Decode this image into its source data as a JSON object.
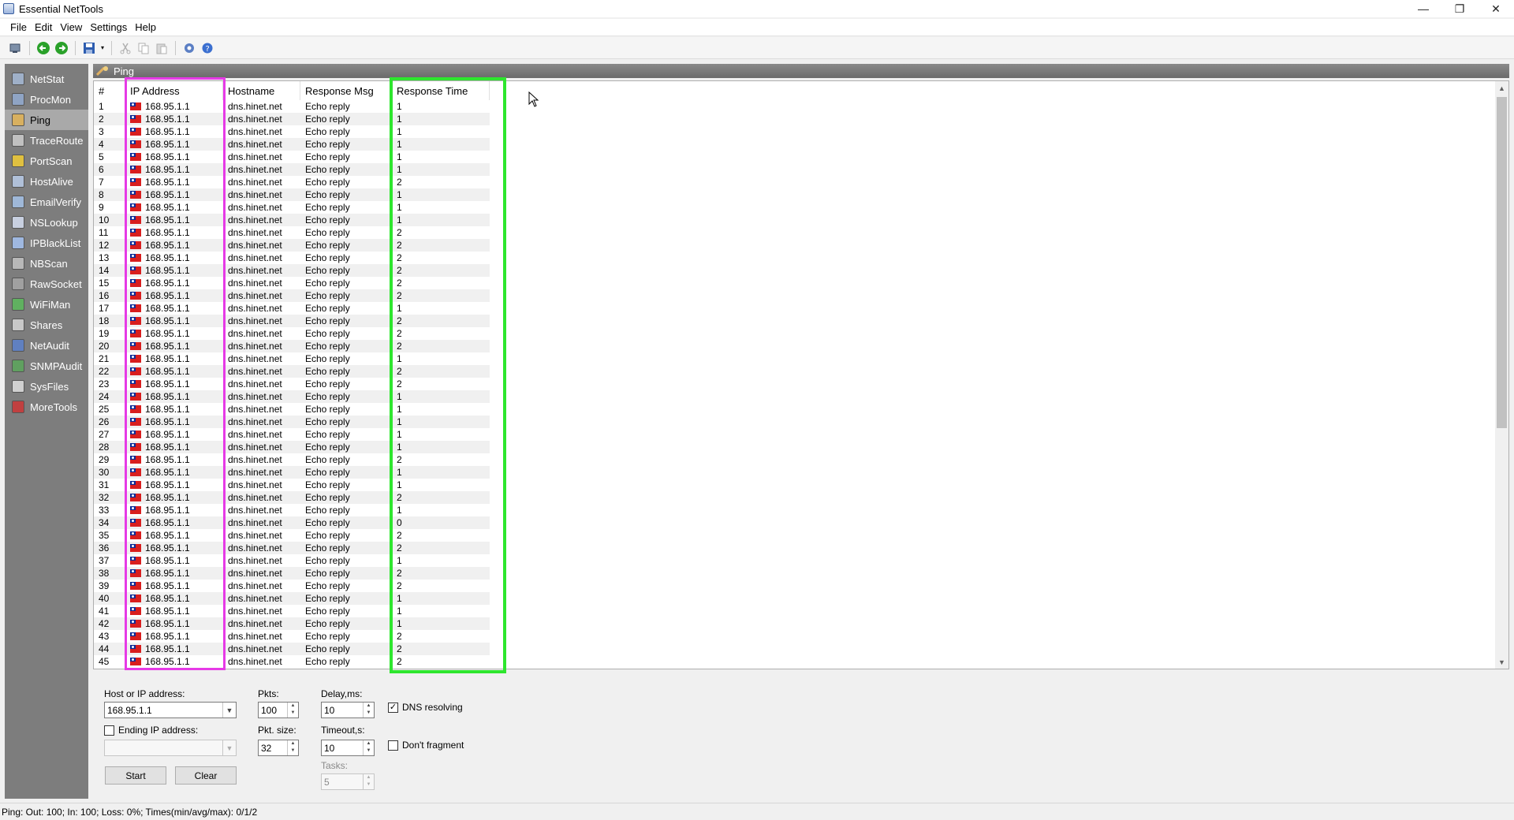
{
  "window": {
    "title": "Essential NetTools",
    "minimize": "—",
    "maximize": "❐",
    "close": "✕"
  },
  "menu": [
    "File",
    "Edit",
    "View",
    "Settings",
    "Help"
  ],
  "sidebar": [
    {
      "label": "NetStat",
      "icon": "netstat-icon"
    },
    {
      "label": "ProcMon",
      "icon": "procmon-icon"
    },
    {
      "label": "Ping",
      "icon": "ping-icon",
      "active": true
    },
    {
      "label": "TraceRoute",
      "icon": "traceroute-icon"
    },
    {
      "label": "PortScan",
      "icon": "portscan-icon"
    },
    {
      "label": "HostAlive",
      "icon": "hostalive-icon"
    },
    {
      "label": "EmailVerify",
      "icon": "emailverify-icon"
    },
    {
      "label": "NSLookup",
      "icon": "nslookup-icon"
    },
    {
      "label": "IPBlackList",
      "icon": "ipblacklist-icon"
    },
    {
      "label": "NBScan",
      "icon": "nbscan-icon"
    },
    {
      "label": "RawSocket",
      "icon": "rawsocket-icon"
    },
    {
      "label": "WiFiMan",
      "icon": "wifiman-icon"
    },
    {
      "label": "Shares",
      "icon": "shares-icon"
    },
    {
      "label": "NetAudit",
      "icon": "netaudit-icon"
    },
    {
      "label": "SNMPAudit",
      "icon": "snmpaudit-icon"
    },
    {
      "label": "SysFiles",
      "icon": "sysfiles-icon"
    },
    {
      "label": "MoreTools",
      "icon": "moretools-icon"
    }
  ],
  "panel": {
    "title": "Ping"
  },
  "grid": {
    "headers": {
      "num": "#",
      "ip": "IP Address",
      "host": "Hostname",
      "msg": "Response Msg",
      "time": "Response Time"
    },
    "ip": "168.95.1.1",
    "hostname": "dns.hinet.net",
    "msg": "Echo reply",
    "times": [
      1,
      1,
      1,
      1,
      1,
      1,
      2,
      1,
      1,
      1,
      2,
      2,
      2,
      2,
      2,
      2,
      1,
      2,
      2,
      2,
      1,
      2,
      2,
      1,
      1,
      1,
      1,
      1,
      2,
      1,
      1,
      2,
      1,
      0,
      2,
      2,
      1,
      2,
      2,
      1,
      1,
      1,
      2,
      2,
      2
    ]
  },
  "options": {
    "host_label": "Host or IP address:",
    "host_value": "168.95.1.1",
    "ending_label": "Ending IP address:",
    "pkts_label": "Pkts:",
    "pkts_value": "100",
    "pktsize_label": "Pkt. size:",
    "pktsize_value": "32",
    "delay_label": "Delay,ms:",
    "delay_value": "10",
    "timeout_label": "Timeout,s:",
    "timeout_value": "10",
    "tasks_label": "Tasks:",
    "tasks_value": "5",
    "dns_label": "DNS resolving",
    "dns_checked": true,
    "frag_label": "Don't fragment",
    "frag_checked": false,
    "start_label": "Start",
    "clear_label": "Clear"
  },
  "status": "Ping: Out: 100; In: 100; Loss: 0%; Times(min/avg/max): 0/1/2"
}
